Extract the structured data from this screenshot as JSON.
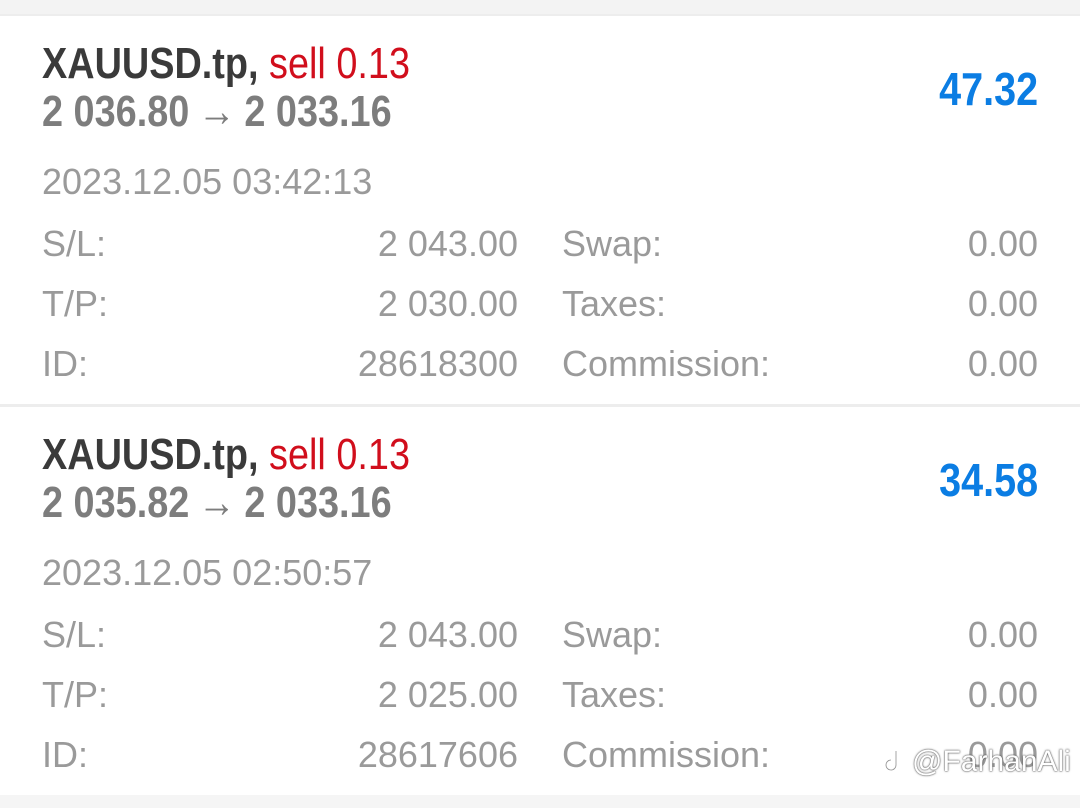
{
  "orders": [
    {
      "symbol": "XAUUSD.tp,",
      "side": "sell 0.13",
      "open_price": "2 036.80",
      "arrow": "→",
      "current_price": "2 033.16",
      "profit": "47.32",
      "time": "2023.12.05 03:42:13",
      "sl_label": "S/L:",
      "sl_value": "2 043.00",
      "tp_label": "T/P:",
      "tp_value": "2 030.00",
      "id_label": "ID:",
      "id_value": "28618300",
      "swap_label": "Swap:",
      "swap_value": "0.00",
      "taxes_label": "Taxes:",
      "taxes_value": "0.00",
      "commission_label": "Commission:",
      "commission_value": "0.00"
    },
    {
      "symbol": "XAUUSD.tp,",
      "side": "sell 0.13",
      "open_price": "2 035.82",
      "arrow": "→",
      "current_price": "2 033.16",
      "profit": "34.58",
      "time": "2023.12.05 02:50:57",
      "sl_label": "S/L:",
      "sl_value": "2 043.00",
      "tp_label": "T/P:",
      "tp_value": "2 025.00",
      "id_label": "ID:",
      "id_value": "28617606",
      "swap_label": "Swap:",
      "swap_value": "0.00",
      "taxes_label": "Taxes:",
      "taxes_value": "0.00",
      "commission_label": "Commission:",
      "commission_value": "0.00"
    }
  ],
  "watermark": {
    "text": "@FarhanAli",
    "icon": "douyin-logo-icon"
  },
  "colors": {
    "sell": "#d10e1c",
    "profit": "#0b7de3",
    "symbol": "#3a3a3a",
    "secondary": "#9a9a9a"
  }
}
